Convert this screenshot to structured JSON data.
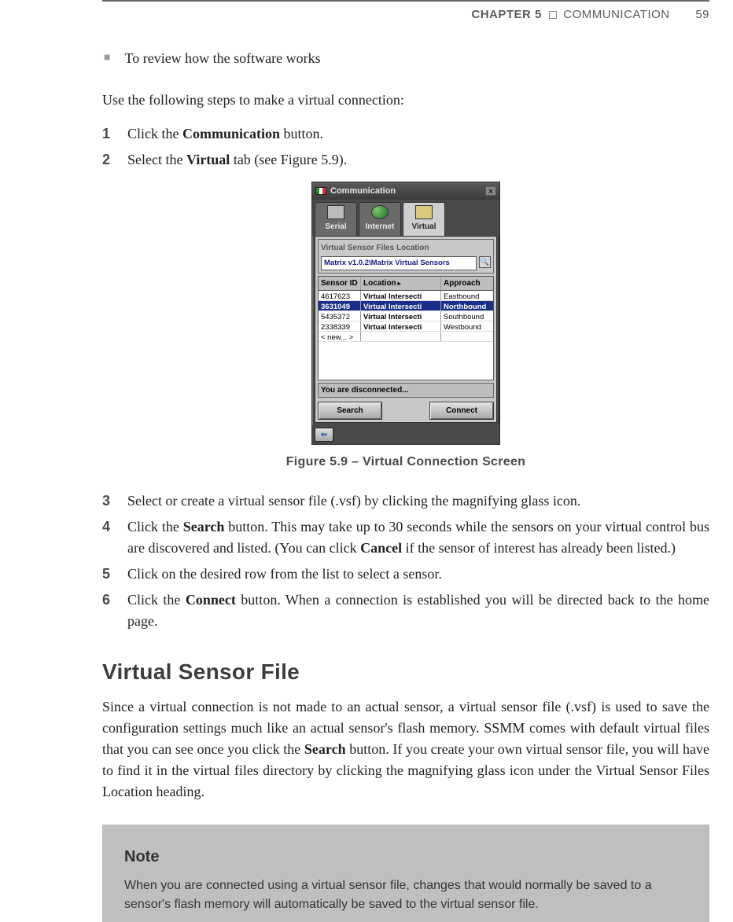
{
  "header": {
    "chapter": "CHAPTER 5",
    "section": "COMMUNICATION",
    "pageno": "59"
  },
  "bullet": "To review how the software works",
  "intro": "Use the following steps to make a virtual connection:",
  "steps1": {
    "s1": {
      "n": "1",
      "pre": "Click the ",
      "b": "Communication",
      "post": " button."
    },
    "s2": {
      "n": "2",
      "pre": "Select the ",
      "b": "Virtual",
      "post": " tab (see Figure 5.9)."
    }
  },
  "figure": {
    "title": "Communication",
    "tabs": {
      "serial": "Serial",
      "internet": "Internet",
      "virtual": "Virtual"
    },
    "group_title": "Virtual Sensor Files Location",
    "path": "Matrix v1.0.2\\Matrix Virtual Sensors",
    "headers": {
      "id": "Sensor ID",
      "loc": "Location",
      "app": "Approach"
    },
    "rows": [
      {
        "id": "4617623",
        "loc": "Virtual Intersecti",
        "app": "Eastbound"
      },
      {
        "id": "3631049",
        "loc": "Virtual Intersecti",
        "app": "Northbound"
      },
      {
        "id": "5435372",
        "loc": "Virtual Intersecti",
        "app": "Southbound"
      },
      {
        "id": "2338339",
        "loc": "Virtual Intersecti",
        "app": "Westbound"
      },
      {
        "id": "< new... >",
        "loc": "",
        "app": ""
      }
    ],
    "status": "You are disconnected...",
    "search_btn": "Search",
    "connect_btn": "Connect",
    "back_arrow": "⇐"
  },
  "caption": "Figure 5.9 – Virtual Connection Screen",
  "steps2": {
    "s3": {
      "n": "3",
      "txt": "Select or create a virtual sensor file (.vsf) by clicking the magnifying glass icon."
    },
    "s4": {
      "n": "4",
      "pre": "Click the ",
      "b": "Search",
      "mid": " button. This may take up to 30 seconds while the sensors on your virtual control bus are discovered and listed. (You can click ",
      "b2": "Cancel",
      "post": " if the sensor of interest has already been listed.)"
    },
    "s5": {
      "n": "5",
      "txt": "Click on the desired row from the list to select a sensor."
    },
    "s6": {
      "n": "6",
      "pre": "Click the ",
      "b": "Connect",
      "post": " button. When a connection is established you will be directed back to the home page."
    }
  },
  "section_title": "Virtual Sensor File",
  "section_body": {
    "pre": "Since a virtual connection is not made to an actual sensor, a virtual sensor file (.vsf) is used to save the configuration settings much like an actual sensor's flash memory. SSMM comes with default virtual files that you can see once you click the ",
    "b": "Search",
    "post": " button. If you create your own virtual sensor file, you will have to find it in the virtual files directory by clicking the magnifying glass icon under the Virtual Sensor Files Location heading."
  },
  "note": {
    "title": "Note",
    "body": "When you are connected using a virtual sensor file, changes that would normally be saved to a sensor's flash memory will automatically be saved to the virtual sensor file."
  }
}
